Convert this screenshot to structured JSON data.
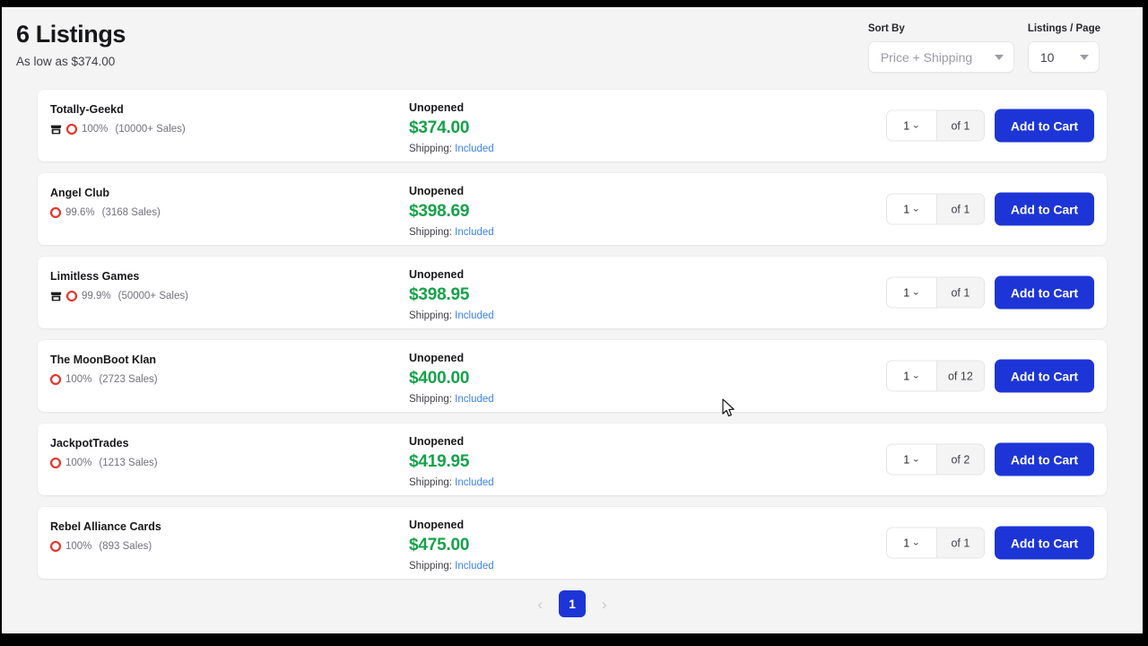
{
  "header": {
    "title": "6 Listings",
    "subtitle": "As low as $374.00",
    "sort": {
      "label": "Sort By",
      "value": "Price + Shipping"
    },
    "per_page": {
      "label": "Listings / Page",
      "value": "10"
    }
  },
  "colors": {
    "accent_blue": "#1d35d6",
    "price_green": "#15a24a",
    "link_blue": "#3b82f6",
    "badge_red": "#e5352b",
    "page_bg": "#f4f4f5",
    "card_bg": "#ffffff"
  },
  "listings": [
    {
      "seller": "Totally-Geekd",
      "has_store_icon": true,
      "feedback": "100%",
      "sales": "(10000+ Sales)",
      "condition": "Unopened",
      "price": "$374.00",
      "shipping_label": "Shipping:",
      "shipping_value": "Included",
      "qty_value": "1",
      "qty_total": "of 1",
      "cart_label": "Add to Cart"
    },
    {
      "seller": "Angel Club",
      "has_store_icon": false,
      "feedback": "99.6%",
      "sales": "(3168 Sales)",
      "condition": "Unopened",
      "price": "$398.69",
      "shipping_label": "Shipping:",
      "shipping_value": "Included",
      "qty_value": "1",
      "qty_total": "of 1",
      "cart_label": "Add to Cart"
    },
    {
      "seller": "Limitless Games",
      "has_store_icon": true,
      "feedback": "99.9%",
      "sales": "(50000+ Sales)",
      "condition": "Unopened",
      "price": "$398.95",
      "shipping_label": "Shipping:",
      "shipping_value": "Included",
      "qty_value": "1",
      "qty_total": "of 1",
      "cart_label": "Add to Cart"
    },
    {
      "seller": "The MoonBoot Klan",
      "has_store_icon": false,
      "feedback": "100%",
      "sales": "(2723 Sales)",
      "condition": "Unopened",
      "price": "$400.00",
      "shipping_label": "Shipping:",
      "shipping_value": "Included",
      "qty_value": "1",
      "qty_total": "of 12",
      "cart_label": "Add to Cart"
    },
    {
      "seller": "JackpotTrades",
      "has_store_icon": false,
      "feedback": "100%",
      "sales": "(1213 Sales)",
      "condition": "Unopened",
      "price": "$419.95",
      "shipping_label": "Shipping:",
      "shipping_value": "Included",
      "qty_value": "1",
      "qty_total": "of 2",
      "cart_label": "Add to Cart"
    },
    {
      "seller": "Rebel Alliance Cards",
      "has_store_icon": false,
      "feedback": "100%",
      "sales": "(893 Sales)",
      "condition": "Unopened",
      "price": "$475.00",
      "shipping_label": "Shipping:",
      "shipping_value": "Included",
      "qty_value": "1",
      "qty_total": "of 1",
      "cart_label": "Add to Cart"
    }
  ],
  "pagination": {
    "prev": "‹",
    "current": "1",
    "next": "›"
  },
  "icons": {
    "store": "store-icon",
    "badge": "seller-badge-icon",
    "caret": "chevron-down-icon"
  }
}
